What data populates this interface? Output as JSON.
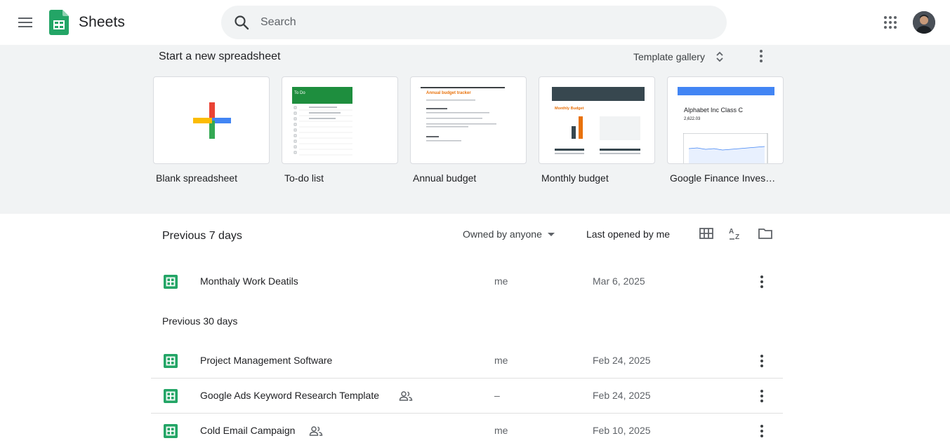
{
  "header": {
    "app_title": "Sheets",
    "search_placeholder": "Search"
  },
  "templates": {
    "heading": "Start a new spreadsheet",
    "gallery_label": "Template gallery",
    "items": [
      {
        "label": "Blank spreadsheet"
      },
      {
        "label": "To-do list"
      },
      {
        "label": "Annual budget"
      },
      {
        "label": "Monthly budget"
      },
      {
        "label": "Google Finance Inves…"
      }
    ],
    "thumb_text": {
      "todo_title": "To Do",
      "annual_title": "Annual budget tracker",
      "monthly_title": "Monthly Budget",
      "finance_title": "Alphabet Inc Class C",
      "finance_price": "2,622.03"
    }
  },
  "list": {
    "section_title": "Previous 7 days",
    "owner_filter": "Owned by anyone",
    "sort_label": "Last opened by me",
    "section_30": "Previous 30 days",
    "rows_7": [
      {
        "name": "Monthaly Work Deatils",
        "owner": "me",
        "date": "Mar 6, 2025",
        "shared": false
      }
    ],
    "rows_30": [
      {
        "name": "Project Management Software",
        "owner": "me",
        "date": "Feb 24, 2025",
        "shared": false
      },
      {
        "name": "Google Ads Keyword Research Template",
        "owner": "–",
        "date": "Feb 24, 2025",
        "shared": true
      },
      {
        "name": "Cold Email Campaign",
        "owner": "me",
        "date": "Feb 10, 2025",
        "shared": true
      }
    ]
  },
  "colors": {
    "sheets_green": "#23a566",
    "panel_bg": "#f1f3f4",
    "plus_red": "#ea4335",
    "plus_blue": "#4285f4",
    "plus_green": "#34a853",
    "plus_yellow": "#fbbc04"
  }
}
